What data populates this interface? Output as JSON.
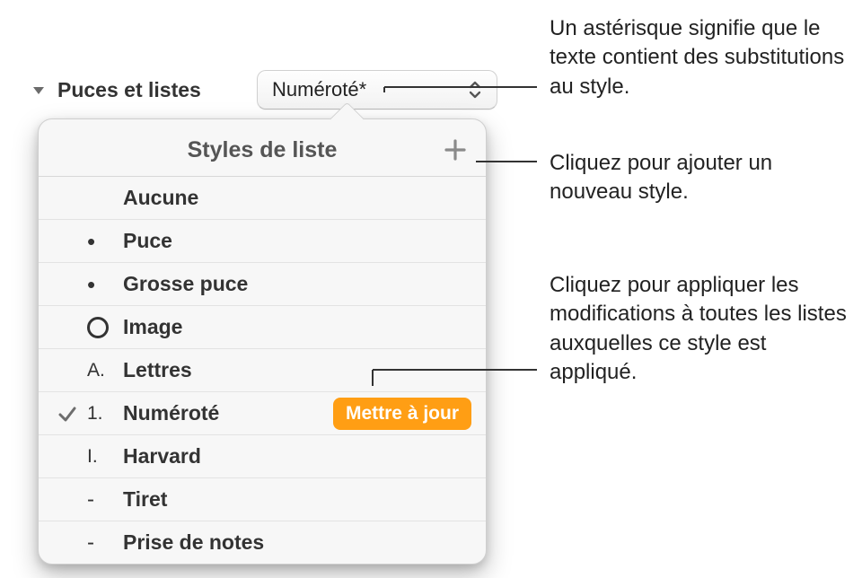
{
  "header": {
    "section_label": "Puces et listes",
    "selected_style": "Numéroté*"
  },
  "popover": {
    "title": "Styles de liste",
    "add_tooltip": "Ajouter",
    "update_label": "Mettre à jour",
    "items": [
      {
        "icon": "",
        "label": "Aucune",
        "selected": false
      },
      {
        "icon": "dot",
        "label": "Puce",
        "selected": false
      },
      {
        "icon": "dot",
        "label": "Grosse puce",
        "selected": false
      },
      {
        "icon": "ring",
        "label": "Image",
        "selected": false
      },
      {
        "icon": "A.",
        "label": "Lettres",
        "selected": false
      },
      {
        "icon": "1.",
        "label": "Numéroté",
        "selected": true
      },
      {
        "icon": "I.",
        "label": "Harvard",
        "selected": false
      },
      {
        "icon": "-",
        "label": "Tiret",
        "selected": false
      },
      {
        "icon": "-",
        "label": "Prise de notes",
        "selected": false
      }
    ]
  },
  "callouts": {
    "asterisk": "Un astérisque signifie que le texte contient des substitutions au style.",
    "add_style": "Cliquez pour ajouter un nouveau style.",
    "update": "Cliquez pour appliquer les modifications à toutes les listes auxquelles ce style est appliqué."
  }
}
